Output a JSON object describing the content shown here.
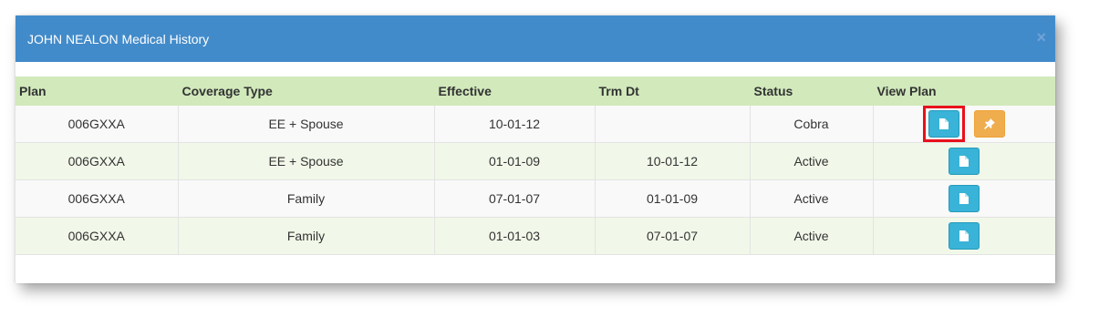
{
  "modal": {
    "title": "JOHN NEALON Medical History",
    "close_label": "×"
  },
  "table": {
    "headers": [
      "Plan",
      "Coverage Type",
      "Effective",
      "Trm Dt",
      "Status",
      "View Plan"
    ],
    "rows": [
      {
        "plan": "006GXXA",
        "coverage": "EE + Spouse",
        "effective": "10-01-12",
        "trm": "",
        "status": "Cobra",
        "actions": [
          "view-plan",
          "pin"
        ]
      },
      {
        "plan": "006GXXA",
        "coverage": "EE + Spouse",
        "effective": "01-01-09",
        "trm": "10-01-12",
        "status": "Active",
        "actions": [
          "view-plan"
        ]
      },
      {
        "plan": "006GXXA",
        "coverage": "Family",
        "effective": "07-01-07",
        "trm": "01-01-09",
        "status": "Active",
        "actions": [
          "view-plan"
        ]
      },
      {
        "plan": "006GXXA",
        "coverage": "Family",
        "effective": "01-01-03",
        "trm": "07-01-07",
        "status": "Active",
        "actions": [
          "view-plan"
        ]
      }
    ]
  },
  "icons": {
    "view": "file-icon",
    "pin": "pushpin-icon"
  },
  "colors": {
    "header": "#428bca",
    "table_header": "#d1e9bb",
    "view_button": "#39b3d7",
    "pin_button": "#f0ad4e",
    "highlight": "#e8101b"
  }
}
